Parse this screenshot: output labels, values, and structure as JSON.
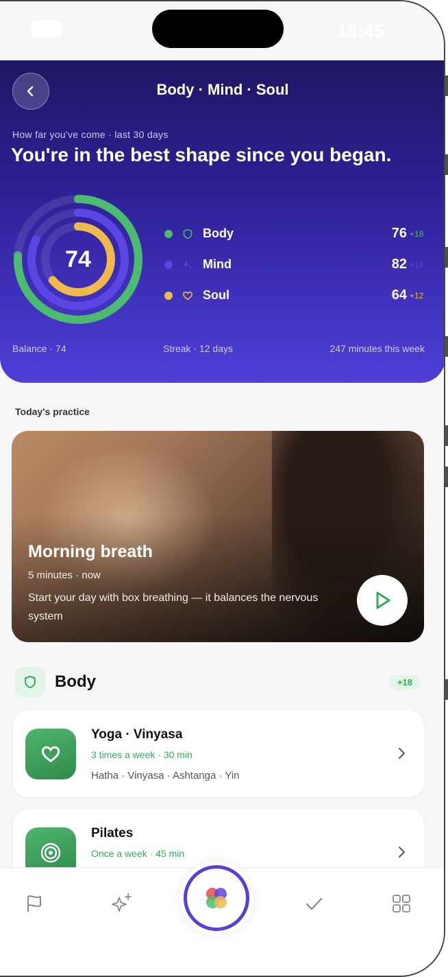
{
  "status_bar": {
    "time": "18:45"
  },
  "header": {
    "title": "Body · Mind · Soul"
  },
  "hero": {
    "subtitle": "How far you've come · last 30 days",
    "headline": "You're in the best shape since you began.",
    "balance_score": "74",
    "rings": [
      {
        "name": "Body",
        "value": 76,
        "color": "#4cbb70"
      },
      {
        "name": "Mind",
        "value": 82,
        "color": "#5b46e4"
      },
      {
        "name": "Soul",
        "value": 64,
        "color": "#f0b94d"
      }
    ],
    "legend": [
      {
        "label": "Body",
        "score": "76",
        "delta": "+18",
        "color": "#4cbb70",
        "delta_color": "#4cbb70",
        "icon": "shield-icon"
      },
      {
        "label": "Mind",
        "score": "82",
        "delta": "+18",
        "color": "#5b46e4",
        "delta_color": "#5b46e4",
        "icon": "sparkle-icon"
      },
      {
        "label": "Soul",
        "score": "64",
        "delta": "+12",
        "color": "#f0b94d",
        "delta_color": "#f0b94d",
        "icon": "heart-icon"
      }
    ],
    "stats": {
      "balance": "Balance · 74",
      "streak": "Streak · 12 days",
      "minutes": "247 minutes this week"
    }
  },
  "practice": {
    "section_label": "Today's practice",
    "title": "Morning breath",
    "meta": "5 minutes · now",
    "description": "Start your day with box breathing — it balances the nervous system"
  },
  "category": {
    "title": "Body",
    "badge": "+18"
  },
  "cards": [
    {
      "title": "Yoga · Vinyasa",
      "frequency": "3 times a week · 30 min",
      "tags": "Hatha · Vinyasa · Ashtanga · Yin",
      "icon": "heart-icon"
    },
    {
      "title": "Pilates",
      "frequency": "Once a week · 45 min",
      "tags": "",
      "icon": "target-icon"
    }
  ],
  "tabbar": {
    "icons": [
      "flag-icon",
      "sparkles-icon",
      "app-logo-icon",
      "check-icon",
      "grid-icon"
    ]
  },
  "colors": {
    "accent": "#5a3fd4",
    "green": "#4cbb70",
    "purple": "#5b46e4",
    "amber": "#f0b94d"
  }
}
